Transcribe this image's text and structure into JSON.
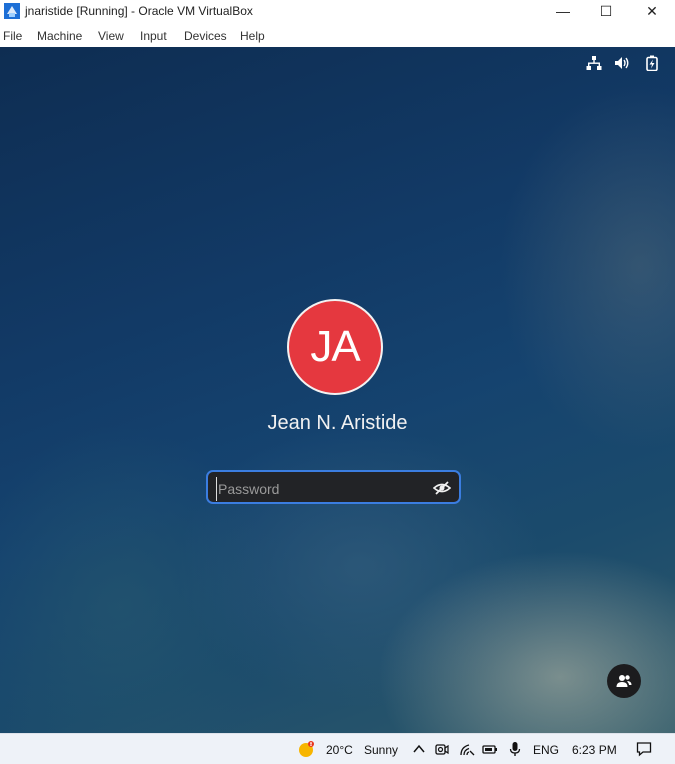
{
  "window": {
    "title": "jnaristide [Running] - Oracle VM VirtualBox",
    "controls": {
      "minimize": "—",
      "maximize": "☐",
      "close": "✕"
    }
  },
  "menu": {
    "file": "File",
    "machine": "Machine",
    "view": "View",
    "input": "Input",
    "devices": "Devices",
    "help": "Help"
  },
  "vm_status_icons": [
    "network-icon",
    "volume-icon",
    "battery-charging-icon"
  ],
  "login": {
    "avatar_initials": "JA",
    "avatar_color": "#e5383f",
    "user_name": "Jean N. Aristide",
    "password_placeholder": "Password",
    "focus_color": "#3b7de0"
  },
  "taskbar": {
    "weather_temp": "20°C",
    "weather_cond": "Sunny",
    "language": "ENG",
    "time": "6:23 PM"
  }
}
